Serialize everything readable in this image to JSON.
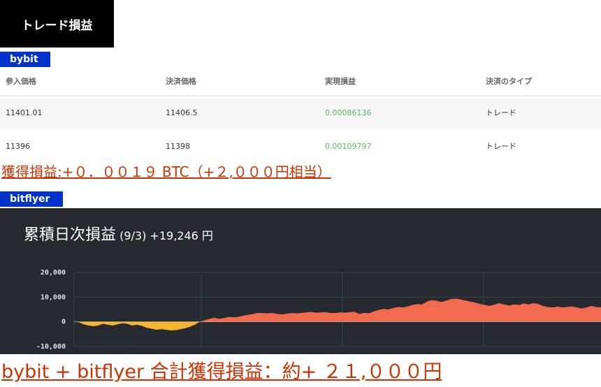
{
  "header": {
    "title": "トレード損益"
  },
  "bybit": {
    "tag": "bybit",
    "columns": [
      "参入価格",
      "決済価格",
      "実現損益",
      "決済のタイプ"
    ],
    "rows": [
      {
        "entry": "11401.01",
        "exit": "11406.5",
        "pnl": "0.00086136",
        "type": "トレード"
      },
      {
        "entry": "11396",
        "exit": "11398",
        "pnl": "0.00109797",
        "type": "トレード"
      }
    ],
    "gain": "獲得損益:+０．００１９ BTC（+２,０００円相当）"
  },
  "bitflyer": {
    "tag": "bitflyer",
    "chart_title": "累積日次損益",
    "chart_subtitle": "(9/3) +19,246 円"
  },
  "total": "bybit + bitflyer 合計獲得損益：約+ ２１,０００円",
  "colors": {
    "positive": "#f26b4f",
    "negative": "#f4b62c",
    "chart_bg": "#262a30",
    "accent_text": "#cc3300",
    "tag_bg": "#0033cc"
  },
  "chart_data": {
    "type": "area",
    "title": "累積日次損益",
    "ylabel": "",
    "ylim": [
      -10000,
      20000
    ],
    "yticks": [
      "20,000",
      "10,000",
      "0",
      "-10,000"
    ],
    "grid": true,
    "values": [
      0,
      -200,
      -1000,
      -1500,
      -1800,
      -1500,
      -800,
      -1200,
      -1500,
      -1000,
      -600,
      -800,
      -1500,
      -1200,
      -1600,
      -2400,
      -2800,
      -3200,
      -3000,
      -3200,
      -3500,
      -3400,
      -3000,
      -2600,
      -2000,
      -1200,
      0,
      600,
      1200,
      1600,
      1200,
      1500,
      2000,
      1800,
      2000,
      2500,
      2800,
      3200,
      3600,
      3500,
      3400,
      3600,
      3200,
      3000,
      3300,
      3500,
      3400,
      3600,
      3800,
      4000,
      3700,
      3800,
      3900,
      3600,
      3500,
      3800,
      3700,
      3900,
      4000,
      3200,
      3600,
      3400,
      4200,
      4800,
      5200,
      5000,
      5600,
      6000,
      5800,
      6200,
      6800,
      7200,
      7000,
      8200,
      8800,
      8500,
      8000,
      8600,
      9200,
      9400,
      9000,
      8600,
      8200,
      7800,
      7200,
      6800,
      6400,
      7000,
      7600,
      7000,
      6600,
      7000,
      6800,
      7400,
      7000,
      7600,
      7200,
      6400,
      6000,
      5800,
      6200,
      5800,
      6000,
      6200,
      5800,
      5400,
      5800,
      6400,
      6000,
      5800
    ]
  }
}
